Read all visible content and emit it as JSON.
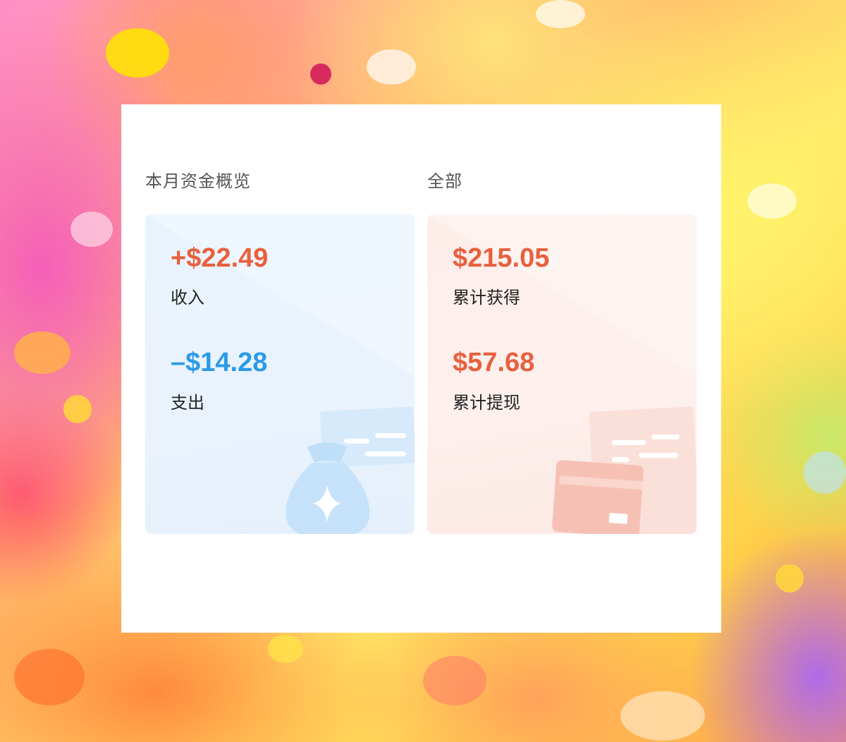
{
  "overview": {
    "monthly_title": "本月资金概览",
    "all_title": "全部"
  },
  "monthly": {
    "income_value": "+$22.49",
    "income_label": "收入",
    "expense_value": "–$14.28",
    "expense_label": "支出",
    "illustration_icon": "money-bag-icon"
  },
  "all_time": {
    "earned_value": "$215.05",
    "earned_label": "累计获得",
    "withdrawn_value": "$57.68",
    "withdrawn_label": "累计提现",
    "illustration_icon": "bank-card-icon"
  },
  "colors": {
    "positive": "#e8603e",
    "negative": "#2b9ae8"
  }
}
